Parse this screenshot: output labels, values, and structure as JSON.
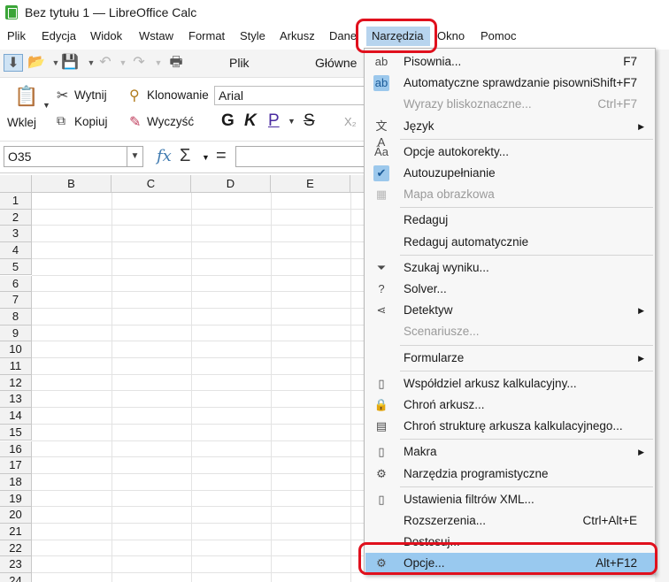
{
  "window": {
    "title": "Bez tytułu 1 — LibreOffice Calc"
  },
  "menubar": {
    "items": [
      "Plik",
      "Edycja",
      "Widok",
      "Wstaw",
      "Format",
      "Style",
      "Arkusz",
      "Dane",
      "Narzędzia",
      "Okno",
      "Pomoc"
    ]
  },
  "toolbar1": {
    "tabs": [
      "Plik",
      "Główne"
    ]
  },
  "toolbar2": {
    "paste_label": "Wklej",
    "cut_label": "Wytnij",
    "copy_label": "Kopiuj",
    "clone_label": "Klonowanie",
    "clear_label": "Wyczyść",
    "font_name": "Arial",
    "bold": "G",
    "italic": "K",
    "underline": "P",
    "strike": "S",
    "sub": "X₂"
  },
  "formula": {
    "cell_ref": "O35",
    "fx": "fx",
    "sum": "Σ",
    "equals": "="
  },
  "grid": {
    "columns": [
      "B",
      "C",
      "D",
      "E"
    ],
    "rows": [
      "1",
      "2",
      "3",
      "4",
      "5",
      "6",
      "7",
      "8",
      "9",
      "10",
      "11",
      "12",
      "13",
      "14",
      "15",
      "16",
      "17",
      "18",
      "19",
      "20",
      "21",
      "22",
      "23",
      "24"
    ]
  },
  "dropdown": {
    "items": [
      {
        "label": "Pisownia...",
        "shortcut": "F7",
        "icon": "spelling-icon",
        "glyph": "ab"
      },
      {
        "label": "Automatyczne sprawdzanie pisowni",
        "shortcut": "Shift+F7",
        "icon": "autospell-icon",
        "glyph": "ab",
        "checked": true
      },
      {
        "label": "Wyrazy bliskoznaczne...",
        "shortcut": "Ctrl+F7",
        "disabled": true
      },
      {
        "label": "Język",
        "submenu": true,
        "icon": "language-icon",
        "glyph": "文A"
      },
      {
        "sep": true
      },
      {
        "label": "Opcje autokorekty...",
        "icon": "autocorrect-icon",
        "glyph": "Ȃa"
      },
      {
        "label": "Autouzupełnianie",
        "icon": "check-icon",
        "glyph": "✔",
        "checked": true
      },
      {
        "label": "Mapa obrazkowa",
        "icon": "imagemap-icon",
        "glyph": "▦",
        "disabled": true
      },
      {
        "sep": true
      },
      {
        "label": "Redaguj"
      },
      {
        "label": "Redaguj automatycznie"
      },
      {
        "sep": true
      },
      {
        "label": "Szukaj wyniku...",
        "icon": "goal-seek-icon",
        "glyph": "⏷"
      },
      {
        "label": "Solver...",
        "icon": "solver-icon",
        "glyph": "?"
      },
      {
        "label": "Detektyw",
        "submenu": true,
        "icon": "detective-icon",
        "glyph": "⋖"
      },
      {
        "label": "Scenariusze...",
        "disabled": true
      },
      {
        "sep": true
      },
      {
        "label": "Formularze",
        "submenu": true
      },
      {
        "sep": true
      },
      {
        "label": "Współdziel arkusz kalkulacyjny...",
        "icon": "share-icon",
        "glyph": "▯"
      },
      {
        "label": "Chroń arkusz...",
        "icon": "protect-sheet-icon",
        "glyph": "🔒"
      },
      {
        "label": "Chroń strukturę arkusza kalkulacyjnego...",
        "icon": "protect-structure-icon",
        "glyph": "▤"
      },
      {
        "sep": true
      },
      {
        "label": "Makra",
        "submenu": true,
        "icon": "macros-icon",
        "glyph": "▯"
      },
      {
        "label": "Narzędzia programistyczne",
        "icon": "devtools-icon",
        "glyph": "⚙"
      },
      {
        "sep": true
      },
      {
        "label": "Ustawienia filtrów XML...",
        "icon": "xml-filter-icon",
        "glyph": "▯"
      },
      {
        "label": "Rozszerzenia...",
        "shortcut": "Ctrl+Alt+E"
      },
      {
        "label": "Dostosuj..."
      },
      {
        "label": "Opcje...",
        "shortcut": "Alt+F12",
        "icon": "options-gear-icon",
        "glyph": "⚙",
        "highlighted": true
      }
    ]
  },
  "colors": {
    "highlight": "#99c9ef",
    "annotation_red": "#e0101d",
    "app_green": "#3aa537"
  }
}
